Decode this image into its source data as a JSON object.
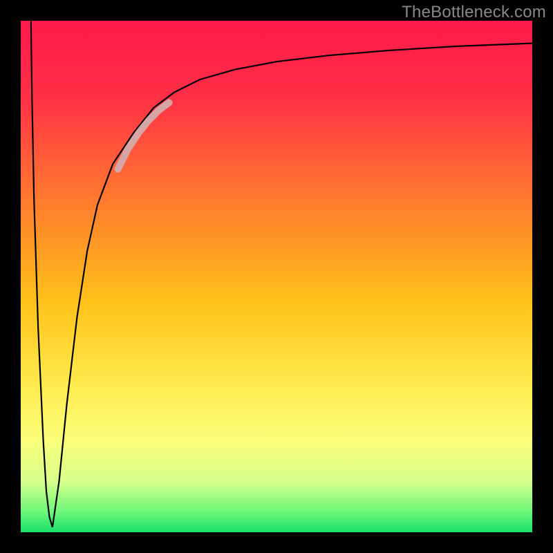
{
  "watermark": "TheBottleneck.com",
  "chart_data": {
    "type": "line",
    "title": "",
    "xlabel": "",
    "ylabel": "",
    "xlim": [
      0,
      100
    ],
    "ylim": [
      0,
      100
    ],
    "grid": false,
    "legend": false,
    "background_gradient": {
      "stops": [
        {
          "offset": 0.0,
          "color": "#ff1a4b"
        },
        {
          "offset": 0.15,
          "color": "#ff2f45"
        },
        {
          "offset": 0.35,
          "color": "#ff7a2e"
        },
        {
          "offset": 0.55,
          "color": "#ffc21a"
        },
        {
          "offset": 0.7,
          "color": "#ffe84a"
        },
        {
          "offset": 0.82,
          "color": "#fbff7a"
        },
        {
          "offset": 0.9,
          "color": "#d7ff8a"
        },
        {
          "offset": 0.96,
          "color": "#6cf77a"
        },
        {
          "offset": 1.0,
          "color": "#18e06a"
        }
      ]
    },
    "series": [
      {
        "name": "left-edge-drop",
        "stroke": "#000000",
        "stroke_width": 2.2,
        "x": [
          2.0,
          2.2,
          2.6,
          3.4,
          4.4,
          5.0,
          5.6,
          6.2
        ],
        "values": [
          100,
          85,
          65,
          40,
          18,
          8,
          3,
          1
        ]
      },
      {
        "name": "main-curve",
        "stroke": "#000000",
        "stroke_width": 2.2,
        "x": [
          6.2,
          7.5,
          9,
          11,
          13,
          15,
          18,
          22,
          26,
          30,
          35,
          42,
          50,
          60,
          72,
          85,
          100
        ],
        "values": [
          1,
          10,
          25,
          42,
          55,
          64,
          72,
          78,
          83,
          86,
          88.5,
          90.5,
          92,
          93.2,
          94.2,
          95,
          95.6
        ]
      },
      {
        "name": "highlight-segment",
        "stroke": "#d6a6a6",
        "stroke_width": 10,
        "linecap": "round",
        "x": [
          19,
          21,
          23,
          25,
          27,
          29
        ],
        "values": [
          71,
          75,
          78,
          80.5,
          82.5,
          84
        ]
      }
    ]
  }
}
